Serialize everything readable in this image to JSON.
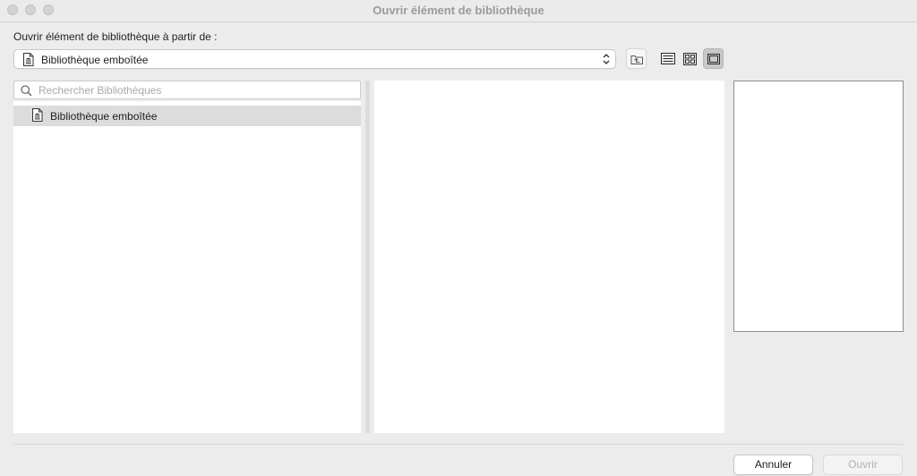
{
  "window": {
    "title": "Ouvrir élément de bibliothèque"
  },
  "source": {
    "label": "Ouvrir élément de bibliothèque à partir de :",
    "selected": "Bibliothèque emboîtée"
  },
  "toolbar": {
    "icons": [
      "folder-up-icon",
      "list-view-icon",
      "grid-view-icon",
      "single-view-icon"
    ],
    "active_view": "single-view"
  },
  "search": {
    "placeholder": "Rechercher Bibliothèques"
  },
  "libraries": [
    {
      "label": "Bibliothèque emboîtée",
      "selected": true,
      "icon": "library-doc-icon"
    }
  ],
  "footer": {
    "cancel_label": "Annuler",
    "open_label": "Ouvrir",
    "open_enabled": false
  }
}
